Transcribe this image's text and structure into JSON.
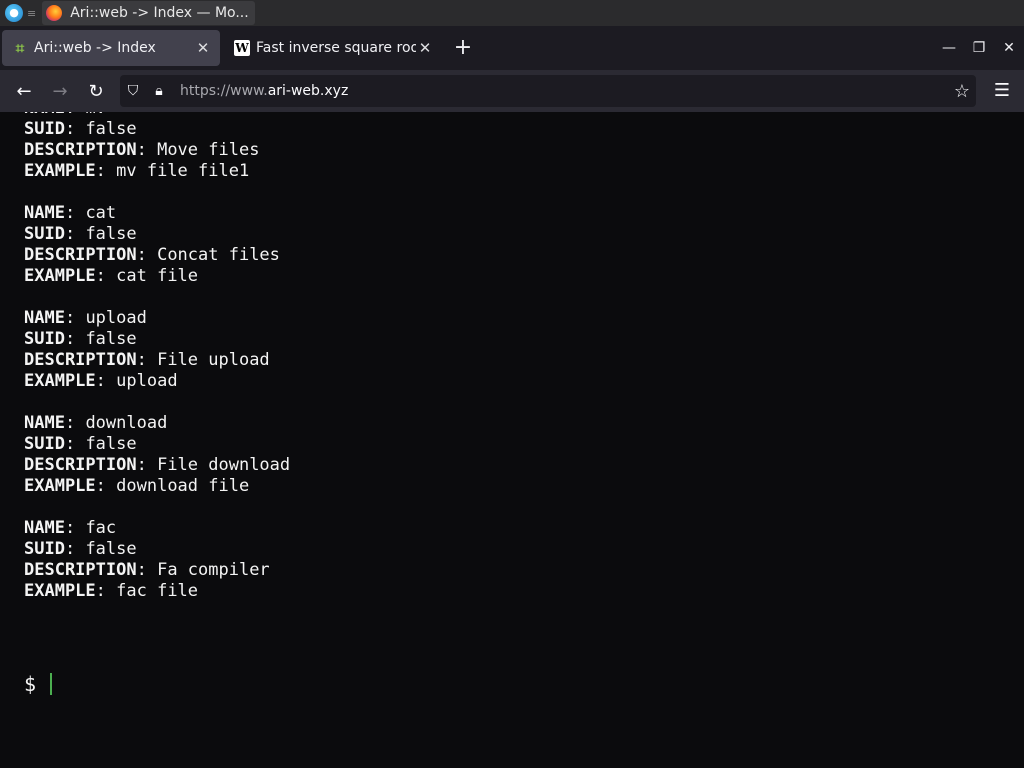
{
  "os": {
    "window_title": "Ari::web -> Index — Mo...",
    "sep": "≡"
  },
  "tabs": [
    {
      "title": "Ari::web -> Index",
      "active": true
    },
    {
      "title": "Fast inverse square root",
      "active": false
    }
  ],
  "url": {
    "prefix": "https://www.",
    "domain": "ari-web.xyz"
  },
  "terminal": {
    "partial_top": {
      "key": "NAME",
      "value": "mv"
    },
    "first_entry_rest": [
      {
        "key": "SUID",
        "value": "false"
      },
      {
        "key": "DESCRIPTION",
        "value": "Move files"
      },
      {
        "key": "EXAMPLE",
        "value": "mv file file1"
      }
    ],
    "entries": [
      [
        {
          "key": "NAME",
          "value": "cat"
        },
        {
          "key": "SUID",
          "value": "false"
        },
        {
          "key": "DESCRIPTION",
          "value": "Concat files"
        },
        {
          "key": "EXAMPLE",
          "value": "cat file"
        }
      ],
      [
        {
          "key": "NAME",
          "value": "upload"
        },
        {
          "key": "SUID",
          "value": "false"
        },
        {
          "key": "DESCRIPTION",
          "value": "File upload"
        },
        {
          "key": "EXAMPLE",
          "value": "upload"
        }
      ],
      [
        {
          "key": "NAME",
          "value": "download"
        },
        {
          "key": "SUID",
          "value": "false"
        },
        {
          "key": "DESCRIPTION",
          "value": "File download"
        },
        {
          "key": "EXAMPLE",
          "value": "download file"
        }
      ],
      [
        {
          "key": "NAME",
          "value": "fac"
        },
        {
          "key": "SUID",
          "value": "false"
        },
        {
          "key": "DESCRIPTION",
          "value": "Fa compiler"
        },
        {
          "key": "EXAMPLE",
          "value": "fac file"
        }
      ]
    ],
    "prompt": "$"
  },
  "icons": {
    "back": "arrow-left-icon",
    "forward": "arrow-right-icon",
    "reload": "reload-icon",
    "shield": "shield-icon",
    "lock": "lock-icon",
    "star": "star-icon",
    "menu": "hamburger-menu-icon"
  },
  "colors": {
    "terminal_bg": "#0b0b0d",
    "terminal_fg": "#f4f4f4",
    "cursor": "#4caf50"
  }
}
